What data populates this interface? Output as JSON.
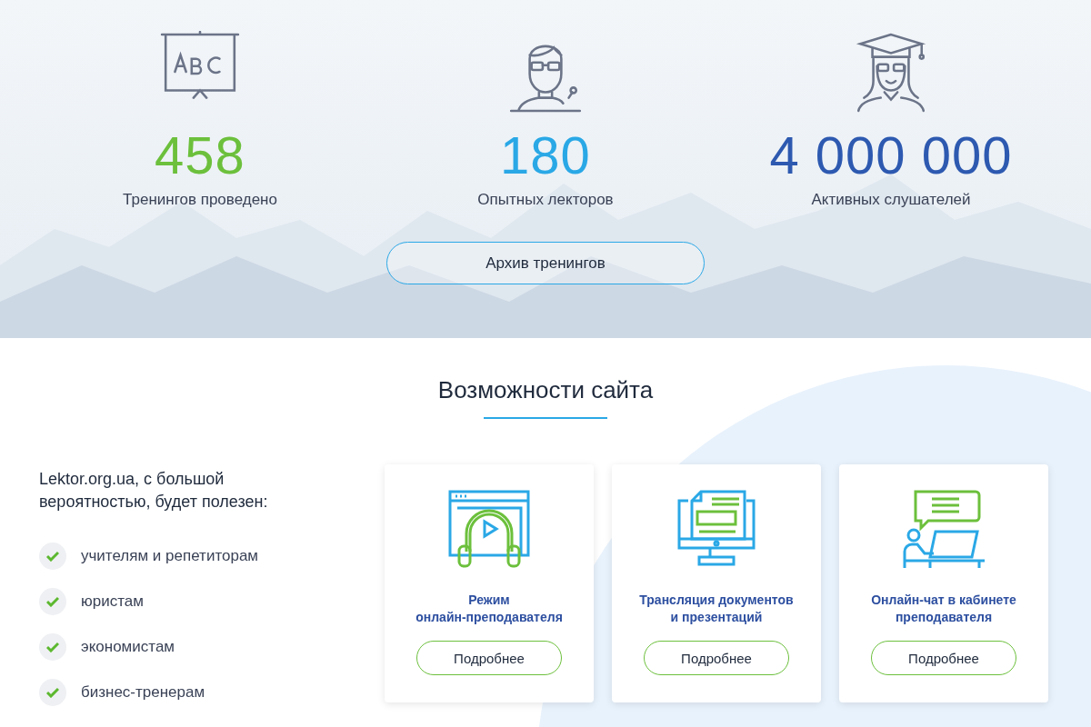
{
  "stats": [
    {
      "kind": "board",
      "number": "458",
      "label": "Тренингов проведено",
      "color": "#6cc03c"
    },
    {
      "kind": "lecturer",
      "number": "180",
      "label": "Опытных лекторов",
      "color": "#2aa8e6"
    },
    {
      "kind": "graduate",
      "number": "4 000 000",
      "label": "Активных слушателей",
      "color": "#2d59b0"
    }
  ],
  "archive_button": "Архив тренингов",
  "features_section": {
    "title": "Возможности сайта",
    "intro": "Lektor.org.ua, с большой вероятностью, будет полезен:",
    "audience": [
      {
        "label": "учителям и репетиторам",
        "checked": true
      },
      {
        "label": "юристам",
        "checked": true
      },
      {
        "label": "экономистам",
        "checked": true
      },
      {
        "label": "бизнес-тренерам",
        "checked": true
      }
    ],
    "cards": [
      {
        "kind": "video",
        "title": "Режим\nонлайн-преподавателя",
        "button": "Подробнее"
      },
      {
        "kind": "monitor",
        "title": "Трансляция документов\nи презентаций",
        "button": "Подробнее"
      },
      {
        "kind": "chat",
        "title": "Онлайн-чат в кабинете\nпреподавателя",
        "button": "Подробнее"
      }
    ]
  }
}
